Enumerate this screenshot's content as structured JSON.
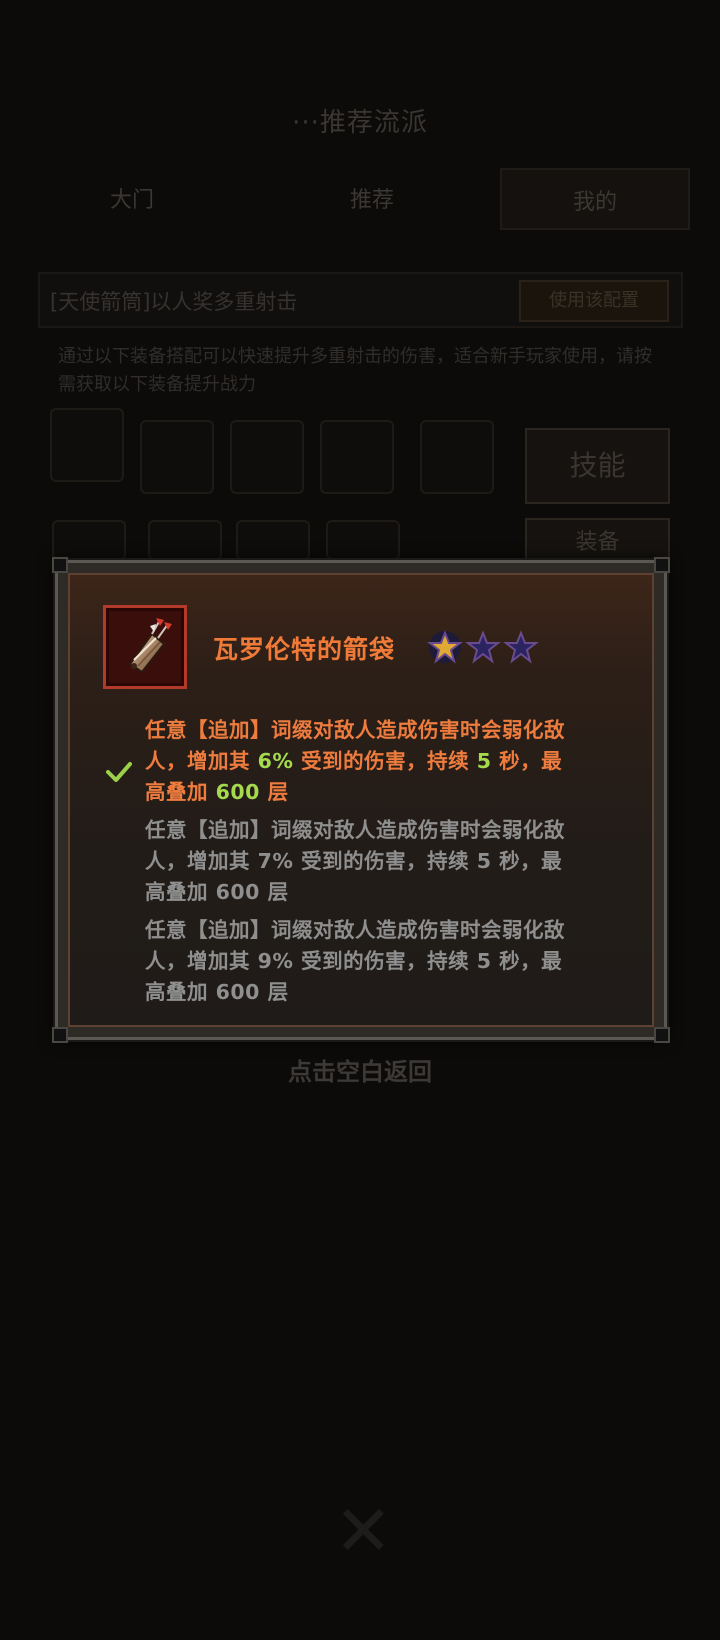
{
  "background": {
    "title": "···推荐流派",
    "tabs": [
      "大门",
      "推荐",
      "我的"
    ],
    "build_name": "[天使箭筒]以人奖多重射击",
    "build_action": "使用该配置",
    "description": "通过以下装备搭配可以快速提升多重射击的伤害，适合新手玩家使用，请按需获取以下装备提升战力",
    "skill_button": "技能",
    "skill_button_2": "装备",
    "hint": "点击空白返回"
  },
  "item": {
    "name": "瓦罗伦特的箭袋",
    "stars_total": 3,
    "stars_filled": 1,
    "icon": "arrow-quiver-icon",
    "colors": {
      "name": "#f07a37",
      "active_affix": "#ed7c3e",
      "highlight_number": "#a5da4f",
      "inactive_affix": "#8f8f8f",
      "star_filled": "#e0a933",
      "star_empty": "#2a2460"
    }
  },
  "affixes": [
    {
      "active": true,
      "line1": "任意【追加】词缀对敌人造成伤害时会弱化敌",
      "line2_a": "人，增加其 ",
      "percent": "6%",
      "line2_b": " 受到的伤害，持续 ",
      "duration": "5",
      "line2_c": " 秒，最",
      "line3_a": "高叠加 ",
      "stacks": "600",
      "line3_b": " 层"
    },
    {
      "active": false,
      "line1": "任意【追加】词缀对敌人造成伤害时会弱化敌",
      "line2": "人，增加其 7% 受到的伤害，持续 5 秒，最",
      "line3": "高叠加 600 层"
    },
    {
      "active": false,
      "line1": "任意【追加】词缀对敌人造成伤害时会弱化敌",
      "line2": "人，增加其 9% 受到的伤害，持续 5 秒，最",
      "line3": "高叠加 600 层"
    }
  ]
}
